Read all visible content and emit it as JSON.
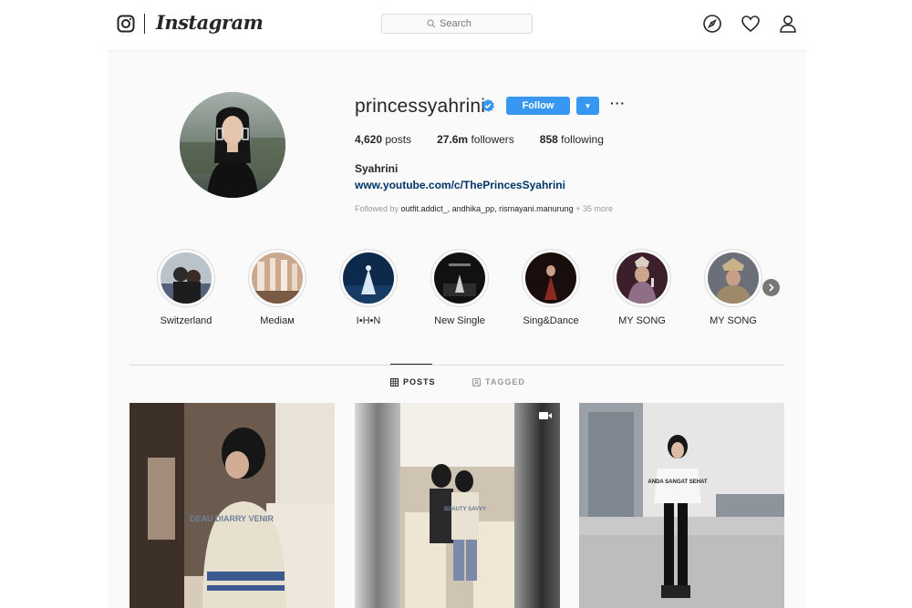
{
  "nav": {
    "brand": "Instagram",
    "search_placeholder": "Search",
    "icons": [
      "instagram-glyph-icon",
      "compass-icon",
      "heart-icon",
      "person-icon"
    ]
  },
  "profile": {
    "username": "princessyahrini",
    "verified": true,
    "follow_label": "Follow",
    "more_label": "···",
    "stats": {
      "posts_count": "4,620",
      "posts_label": "posts",
      "followers_count": "27.6m",
      "followers_label": "followers",
      "following_count": "858",
      "following_label": "following"
    },
    "full_name": "Syahrini",
    "link": "www.youtube.com/c/ThePrincesSyahrini",
    "followed_by_prefix": "Followed by",
    "followed_by_names": "outfit.addict_, andhika_pp, rismayani.manurung",
    "followed_by_more": "+ 35 more"
  },
  "highlights": [
    {
      "label": "Switzerland"
    },
    {
      "label": "Mediaᴍ"
    },
    {
      "label": "I•H•N"
    },
    {
      "label": "New Single"
    },
    {
      "label": "Sing&Dance"
    },
    {
      "label": "MY SONG"
    },
    {
      "label": "MY SONG"
    }
  ],
  "tabs": {
    "posts": "POSTS",
    "tagged": "TAGGED"
  },
  "posts": [
    {
      "subject": "woman in cardigan on jet",
      "print": "DEAU DIARRY VENIR"
    },
    {
      "subject": "couple on private jet",
      "print": "BEAUTY SAVVY"
    },
    {
      "subject": "woman in slogan tee",
      "print": "ANDA SANGAT SEHAT"
    }
  ],
  "colors": {
    "accent": "#3897f0",
    "link": "#003569",
    "background": "#fafafa",
    "text": "#262626",
    "muted": "#999999"
  }
}
